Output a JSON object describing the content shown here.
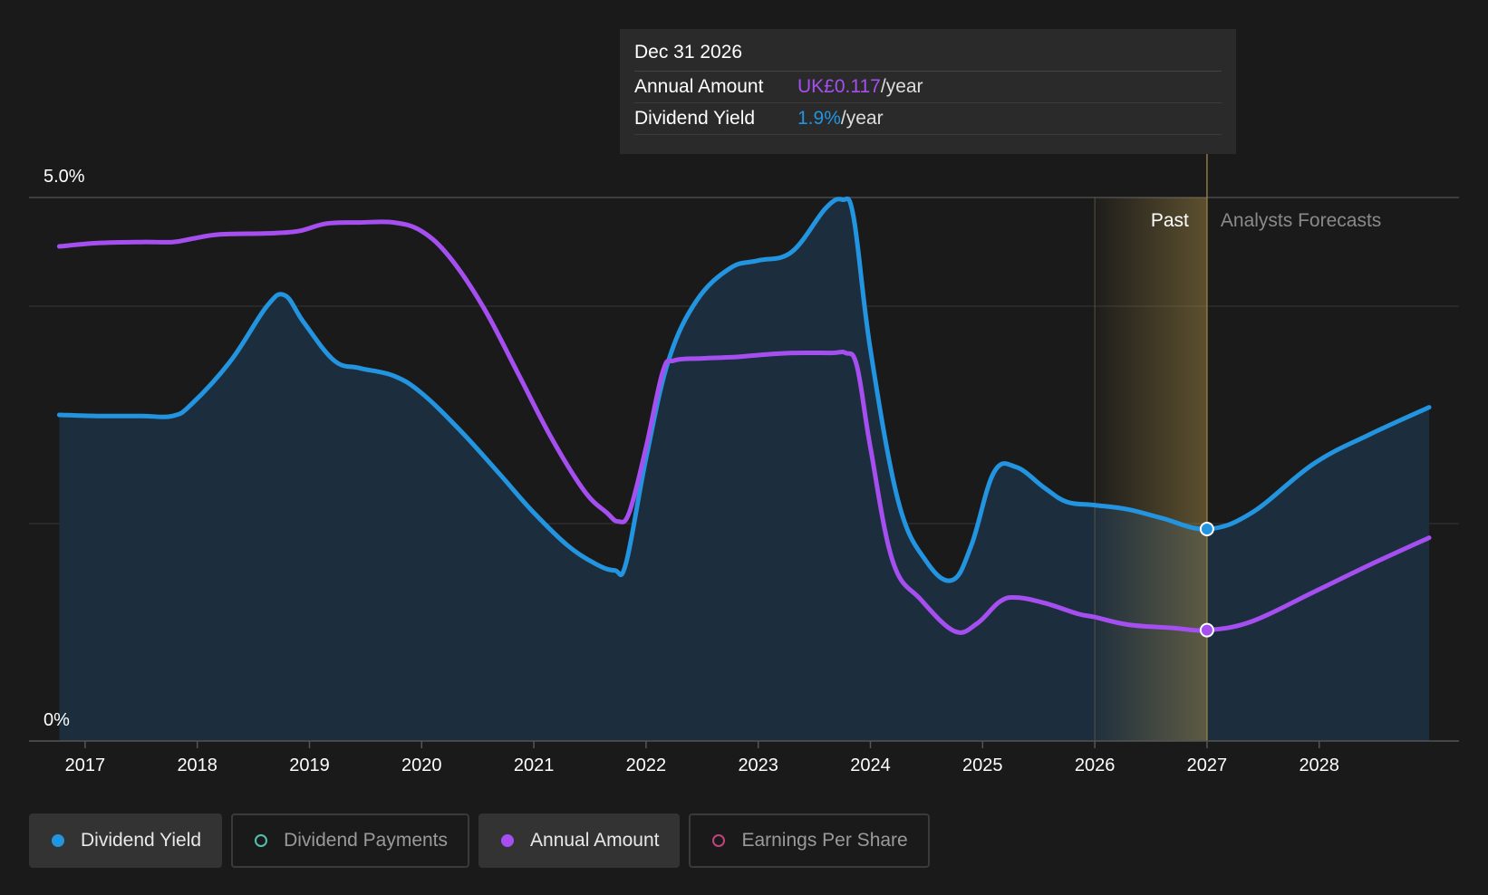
{
  "chart_data": {
    "type": "area",
    "y_ticks": [
      "5.0%",
      "0%"
    ],
    "ylim": [
      0,
      5.0
    ],
    "x_ticks": [
      "2017",
      "2018",
      "2019",
      "2020",
      "2021",
      "2022",
      "2023",
      "2024",
      "2025",
      "2026",
      "2027",
      "2028"
    ],
    "xlim": [
      2016.5,
      2028.98
    ],
    "grid": true,
    "regions": {
      "past_label": "Past",
      "forecast_label": "Analysts Forecasts",
      "past_start": 2026.0,
      "boundary": 2027.0
    },
    "series": [
      {
        "name": "Dividend Yield",
        "color": "#2394df",
        "x": [
          2016.77,
          2017.1,
          2017.5,
          2017.78,
          2017.95,
          2018.3,
          2018.62,
          2018.78,
          2018.95,
          2019.22,
          2019.45,
          2019.75,
          2020.0,
          2020.35,
          2020.7,
          2021.0,
          2021.3,
          2021.55,
          2021.72,
          2021.82,
          2022.0,
          2022.2,
          2022.45,
          2022.75,
          2023.0,
          2023.3,
          2023.6,
          2023.75,
          2023.85,
          2024.0,
          2024.25,
          2024.5,
          2024.73,
          2024.9,
          2025.1,
          2025.3,
          2025.55,
          2025.75,
          2026.0,
          2026.3,
          2026.6,
          2027.0,
          2027.4,
          2027.95,
          2028.45,
          2028.98
        ],
        "y": [
          3.0,
          2.99,
          2.99,
          2.99,
          3.1,
          3.5,
          4.0,
          4.1,
          3.85,
          3.5,
          3.43,
          3.36,
          3.2,
          2.85,
          2.45,
          2.1,
          1.8,
          1.63,
          1.57,
          1.63,
          2.6,
          3.5,
          4.05,
          4.35,
          4.42,
          4.5,
          4.9,
          4.98,
          4.82,
          3.6,
          2.2,
          1.65,
          1.48,
          1.8,
          2.47,
          2.52,
          2.33,
          2.2,
          2.17,
          2.13,
          2.05,
          1.95,
          2.1,
          2.55,
          2.82,
          3.07
        ]
      },
      {
        "name": "Annual Amount",
        "color": "#a64ff0",
        "x": [
          2016.77,
          2017.1,
          2017.5,
          2017.78,
          2017.95,
          2018.2,
          2018.62,
          2018.9,
          2019.15,
          2019.45,
          2019.75,
          2020.0,
          2020.25,
          2020.55,
          2020.85,
          2021.15,
          2021.45,
          2021.65,
          2021.75,
          2021.85,
          2022.0,
          2022.15,
          2022.25,
          2022.5,
          2022.75,
          2023.0,
          2023.3,
          2023.65,
          2023.78,
          2023.88,
          2024.0,
          2024.2,
          2024.45,
          2024.75,
          2024.95,
          2025.15,
          2025.3,
          2025.55,
          2025.85,
          2026.0,
          2026.3,
          2026.7,
          2027.0,
          2027.4,
          2027.95,
          2028.45,
          2028.98
        ],
        "y": [
          4.55,
          4.58,
          4.59,
          4.59,
          4.62,
          4.66,
          4.67,
          4.69,
          4.76,
          4.77,
          4.77,
          4.69,
          4.45,
          3.99,
          3.4,
          2.8,
          2.3,
          2.1,
          2.02,
          2.1,
          2.7,
          3.4,
          3.5,
          3.52,
          3.53,
          3.55,
          3.57,
          3.57,
          3.57,
          3.45,
          2.7,
          1.65,
          1.3,
          1.01,
          1.08,
          1.28,
          1.32,
          1.27,
          1.17,
          1.14,
          1.07,
          1.04,
          1.02,
          1.1,
          1.37,
          1.62,
          1.87
        ]
      }
    ]
  },
  "tooltip": {
    "date": "Dec 31 2026",
    "rows": [
      {
        "label": "Annual Amount",
        "value": "UK£0.117",
        "unit": "/year",
        "color": "#a64ff0"
      },
      {
        "label": "Dividend Yield",
        "value": "1.9%",
        "unit": "/year",
        "color": "#2394df"
      }
    ]
  },
  "legend": [
    {
      "label": "Dividend Yield",
      "color": "#2394df",
      "active": true
    },
    {
      "label": "Dividend Payments",
      "color": "#4fc3b0",
      "active": false
    },
    {
      "label": "Annual Amount",
      "color": "#a64ff0",
      "active": true
    },
    {
      "label": "Earnings Per Share",
      "color": "#c2427c",
      "active": false
    }
  ]
}
